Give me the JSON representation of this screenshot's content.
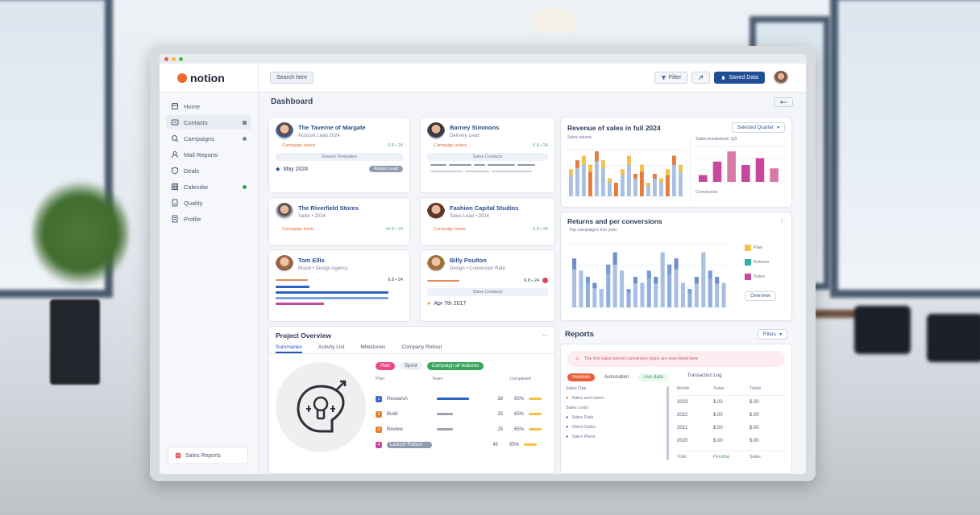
{
  "app": {
    "logo_text": "notion",
    "search_label": "Search here"
  },
  "toolbar": {
    "filter_label": "Filter",
    "share_label": "Share",
    "primary_label": "Saved Data"
  },
  "sidebar": {
    "items": [
      {
        "label": "Home",
        "icon": "home-icon"
      },
      {
        "label": "Contacts",
        "icon": "contacts-icon",
        "active": true
      },
      {
        "label": "Campaigns",
        "icon": "search-icon"
      },
      {
        "label": "Mail Reports",
        "icon": "user-icon"
      },
      {
        "label": "Deals",
        "icon": "shield-icon"
      },
      {
        "label": "Calendar",
        "icon": "grid-icon"
      },
      {
        "label": "Quality",
        "icon": "doc-icon"
      },
      {
        "label": "Profile",
        "icon": "doc-icon"
      }
    ],
    "footer_label": "Sales Reports"
  },
  "dashboard": {
    "title": "Dashboard"
  },
  "people": [
    {
      "name": "The Taverne of Margate",
      "role": "Account Lead 2024",
      "tag": "Campaign status",
      "meta": "Shared Templates",
      "date": "May 2024",
      "pill": "Assign Lead",
      "stat": "6.8 • 24"
    },
    {
      "name": "Barney Simmons",
      "role": "Delivery Lead",
      "tag": "Campaign status",
      "meta": "Sales Contacts",
      "stat": "6.8 • 24"
    },
    {
      "name": "The Riverfield Stores",
      "role": "Sales • 2024",
      "tag": "Campaign leads",
      "stat": "+6.8 • 24"
    },
    {
      "name": "Fashion Capital Studios",
      "role": "Sales Lead • 2024",
      "tag": "Campaign leads",
      "stat": "6.8 • 24"
    },
    {
      "name": "Tom Ellis",
      "role": "Brand • Design Agency",
      "stat": "6.8 • 24"
    },
    {
      "name": "Billy Poulton",
      "role": "Design • Conversion Rate",
      "meta": "Sales Contacts",
      "date": "Apr 7th 2017",
      "stat": "6.8 • 24"
    }
  ],
  "revenue_panel": {
    "title": "Revenue of sales in full 2024",
    "dropdown": "Selected Quarter",
    "sub_legend": "Sales volume",
    "right_title": "Sales breakdown Q3",
    "right_footer": "Conversion"
  },
  "customers_panel": {
    "title": "Returns and per conversions",
    "legend_title": "Top campaigns this year",
    "legend": [
      {
        "label": "Plan",
        "color": "#f4c24a"
      },
      {
        "label": "Returns",
        "color": "#2db3a6"
      },
      {
        "label": "Sales",
        "color": "#c6479c"
      }
    ],
    "button": "Overview"
  },
  "project": {
    "title": "Project Overview",
    "tabs": [
      "Summaries",
      "Activity List",
      "Milestones",
      "Company Rollout"
    ],
    "chips": [
      {
        "label": "Plan",
        "color": "#e94a86"
      },
      {
        "label": "Sprint",
        "color": "#9aa4b5"
      },
      {
        "label": "Campaign all features",
        "color": "#3aa55d"
      }
    ],
    "cols": [
      "Plan",
      "Team",
      "Completed"
    ],
    "rows": [
      {
        "n": "1",
        "color": "#3a68c2",
        "label": "Research",
        "bar": "#2c62c4",
        "val": "28",
        "pct": "65%"
      },
      {
        "n": "2",
        "color": "#e6802c",
        "label": "Build",
        "bar": "#9aa4b5",
        "val": "25",
        "pct": "65%"
      },
      {
        "n": "3",
        "color": "#e6802c",
        "label": "Review",
        "bar": "#9aa4b5",
        "val": "25",
        "pct": "65%"
      },
      {
        "n": "4",
        "color": "#c6479c",
        "label": "Launch Rollout",
        "bar": "#9aa4b5",
        "val": "45",
        "pct": "65%"
      }
    ]
  },
  "reports": {
    "title": "Reports",
    "dropdown": "Filters",
    "alert": "The first sales funnel conversion plans are now listed here",
    "chips": [
      "Invoices",
      "Automation",
      "Live data"
    ],
    "right_title": "Transaction Log",
    "left_rows": [
      "Sales Ops",
      "Sales and Users",
      "Sales Lead",
      "Sales Data",
      "Client Sales",
      "Sales Plans"
    ],
    "table_head": [
      "Month",
      "Sales",
      "Totals"
    ],
    "table_rows": [
      [
        "2023",
        "$.00",
        "$.00"
      ],
      [
        "2022",
        "$.00",
        "$.00"
      ],
      [
        "2021",
        "$.00",
        "$.00"
      ],
      [
        "2020",
        "$.00",
        "$.00"
      ]
    ],
    "footer": [
      "Total",
      "Pending",
      "Sales"
    ]
  },
  "chart_data": [
    {
      "type": "bar",
      "title": "Revenue of sales in full 2024",
      "series": [
        {
          "values": [
            6,
            8,
            9,
            7,
            10,
            8,
            4,
            3,
            6,
            9,
            5,
            7,
            3,
            5,
            4,
            6,
            9,
            7
          ]
        }
      ]
    },
    {
      "type": "bar",
      "title": "Sales breakdown Q3",
      "series": [
        {
          "values": [
            2,
            6,
            9,
            5,
            7,
            4
          ]
        }
      ]
    },
    {
      "type": "bar",
      "title": "Returns and per conversions",
      "series": [
        {
          "values": [
            8,
            6,
            5,
            4,
            3,
            7,
            9,
            6,
            3,
            5,
            4,
            6,
            5,
            9,
            7,
            8,
            4,
            3,
            5,
            9,
            6,
            5,
            4
          ]
        }
      ]
    }
  ],
  "colors": {
    "accent": "#1f4e96",
    "link": "#2c4b8a",
    "brand": "#f06a2b"
  }
}
